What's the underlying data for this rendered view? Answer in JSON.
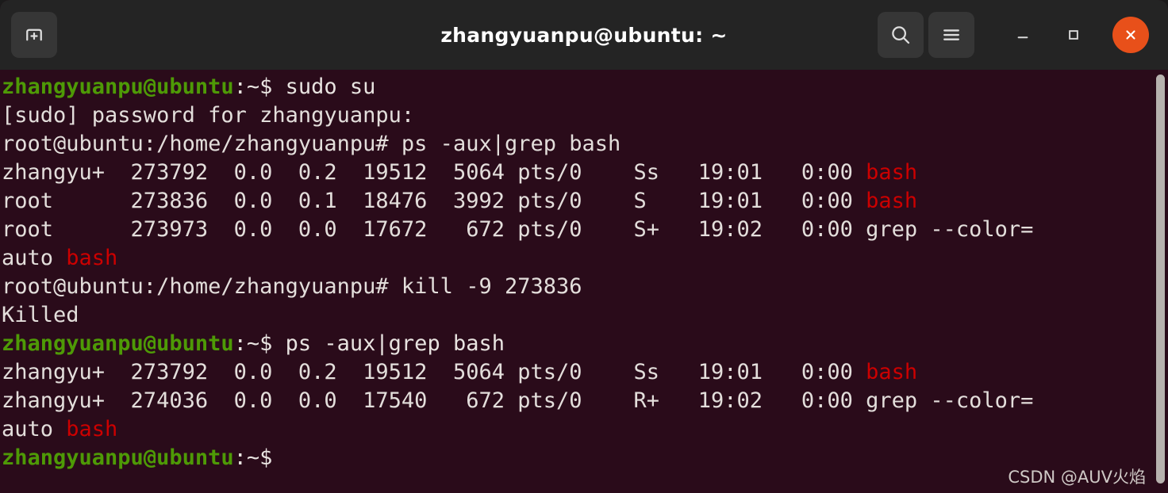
{
  "window": {
    "title": "zhangyuanpu@ubuntu: ~",
    "background_color": "#2a0b1a",
    "titlebar_color": "#242424",
    "close_button_color": "#e8501a"
  },
  "titlebar": {
    "new_tab_label": "new-tab",
    "search_label": "search",
    "menu_label": "menu",
    "minimize_label": "minimize",
    "maximize_label": "maximize",
    "close_label": "close"
  },
  "colors": {
    "prompt_green": "#4e9a06",
    "text_white": "#e3dedb",
    "grep_match_red": "#cc0000",
    "scrollbar": "#b7b2ae"
  },
  "terminal": {
    "lines": [
      {
        "id": "line-1",
        "segments": [
          {
            "text": "zhangyuanpu@ubuntu",
            "style": "green"
          },
          {
            "text": ":~$ sudo su",
            "style": "white"
          }
        ]
      },
      {
        "id": "line-2",
        "segments": [
          {
            "text": "[sudo] password for zhangyuanpu:",
            "style": "plain"
          }
        ]
      },
      {
        "id": "line-3",
        "segments": [
          {
            "text": "root@ubuntu:/home/zhangyuanpu# ps -aux|grep bash",
            "style": "plain"
          }
        ]
      },
      {
        "id": "line-4",
        "segments": [
          {
            "text": "zhangyu+  273792  0.0  0.2  19512  5064 pts/0    Ss   19:01   0:00 ",
            "style": "plain"
          },
          {
            "text": "bash",
            "style": "red"
          }
        ]
      },
      {
        "id": "line-5",
        "segments": [
          {
            "text": "root      273836  0.0  0.1  18476  3992 pts/0    S    19:01   0:00 ",
            "style": "plain"
          },
          {
            "text": "bash",
            "style": "red"
          }
        ]
      },
      {
        "id": "line-6",
        "segments": [
          {
            "text": "root      273973  0.0  0.0  17672   672 pts/0    S+   19:02   0:00 grep --color=",
            "style": "plain"
          }
        ]
      },
      {
        "id": "line-7",
        "segments": [
          {
            "text": "auto ",
            "style": "plain"
          },
          {
            "text": "bash",
            "style": "red"
          }
        ]
      },
      {
        "id": "line-8",
        "segments": [
          {
            "text": "root@ubuntu:/home/zhangyuanpu# kill -9 273836",
            "style": "plain"
          }
        ]
      },
      {
        "id": "line-9",
        "segments": [
          {
            "text": "Killed",
            "style": "plain"
          }
        ]
      },
      {
        "id": "line-10",
        "segments": [
          {
            "text": "zhangyuanpu@ubuntu",
            "style": "green"
          },
          {
            "text": ":~$ ps -aux|grep bash",
            "style": "white"
          }
        ]
      },
      {
        "id": "line-11",
        "segments": [
          {
            "text": "zhangyu+  273792  0.0  0.2  19512  5064 pts/0    Ss   19:01   0:00 ",
            "style": "plain"
          },
          {
            "text": "bash",
            "style": "red"
          }
        ]
      },
      {
        "id": "line-12",
        "segments": [
          {
            "text": "zhangyu+  274036  0.0  0.0  17540   672 pts/0    R+   19:02   0:00 grep --color=",
            "style": "plain"
          }
        ]
      },
      {
        "id": "line-13",
        "segments": [
          {
            "text": "auto ",
            "style": "plain"
          },
          {
            "text": "bash",
            "style": "red"
          }
        ]
      },
      {
        "id": "line-14",
        "segments": [
          {
            "text": "zhangyuanpu@ubuntu",
            "style": "green"
          },
          {
            "text": ":~$ ",
            "style": "white"
          }
        ]
      }
    ]
  },
  "watermark": {
    "text": "CSDN @AUV火焰"
  }
}
